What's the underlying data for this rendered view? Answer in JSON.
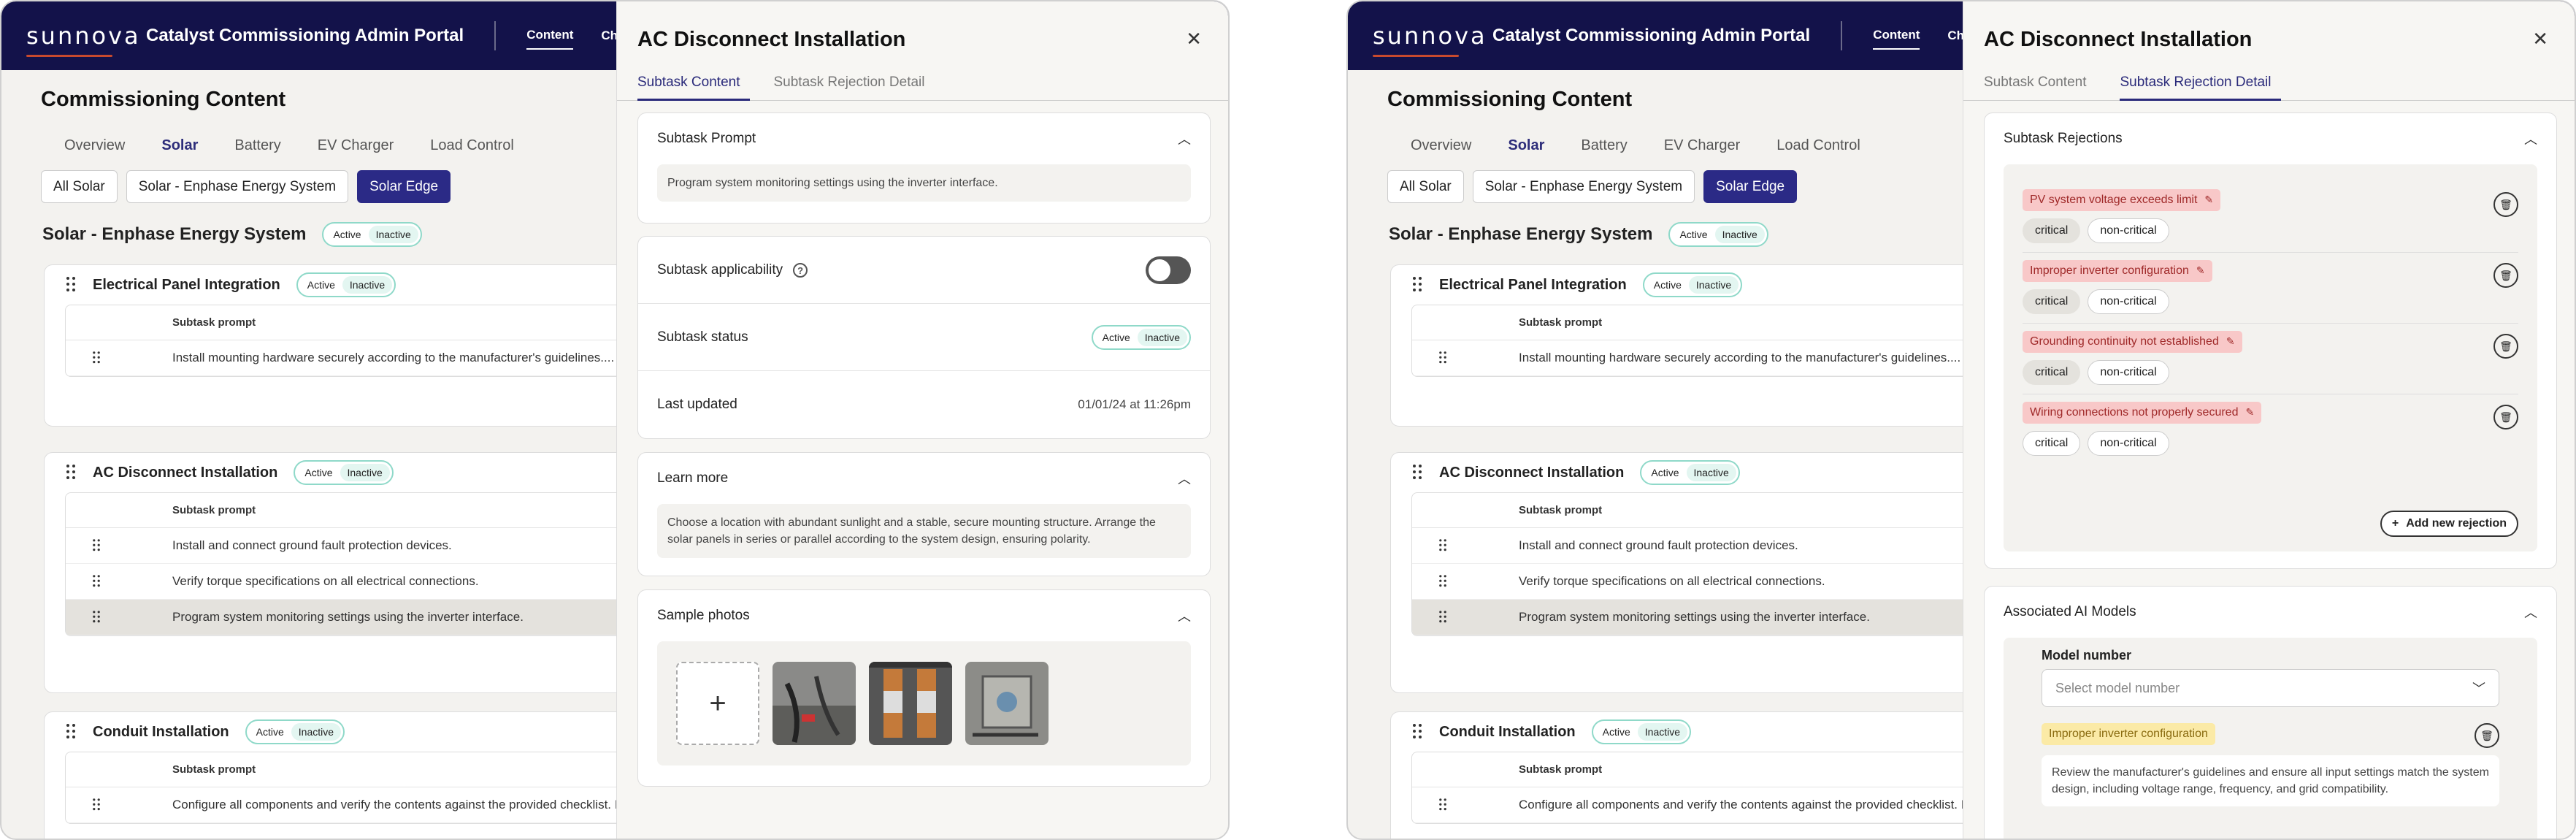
{
  "brand": {
    "logo": "sunnova",
    "app_title": "Catalyst Commissioning Admin Portal"
  },
  "nav": {
    "content": "Content",
    "change_log": "Change lo"
  },
  "page": {
    "title": "Commissioning Content",
    "section": "Solar - Enphase Energy System"
  },
  "tabs": [
    "Overview",
    "Solar",
    "Battery",
    "EV Charger",
    "Load Control"
  ],
  "pills": [
    "All Solar",
    "Solar - Enphase Energy System",
    "Solar Edge"
  ],
  "toggle": {
    "active": "Active",
    "inactive": "Inactive"
  },
  "cards": [
    {
      "title": "Electrical Panel Integration",
      "header": "Subtask prompt",
      "rows": [
        "Install mounting hardware securely according to the manufacturer's guidelines...."
      ]
    },
    {
      "title": "AC Disconnect Installation",
      "header": "Subtask prompt",
      "rows": [
        "Install and connect ground fault protection devices.",
        "Verify torque specifications on all electrical connections.",
        "Program system monitoring settings using the inverter interface."
      ]
    },
    {
      "title": "Conduit Installation",
      "header": "Subtask prompt",
      "rows": [
        "Configure all components and verify the contents against the provided checklist. Install"
      ]
    }
  ],
  "panel": {
    "title": "AC Disconnect Installation",
    "close_icon": "close-icon",
    "tab_content": "Subtask Content",
    "tab_rejection": "Subtask Rejection Detail",
    "prompt_title": "Subtask Prompt",
    "prompt_text": "Program system monitoring settings using the inverter interface.",
    "applicability": "Subtask applicability",
    "status": "Subtask status",
    "last_updated_label": "Last updated",
    "last_updated_value": "01/01/24 at 11:26pm",
    "learn_more": "Learn more",
    "learn_more_text": "Choose a location with abundant sunlight and a stable, secure mounting structure. Arrange the solar panels in series or parallel according to the system design, ensuring polarity.",
    "sample_photos": "Sample photos",
    "rejections_title": "Subtask Rejections",
    "rejections": [
      {
        "label": "PV system voltage exceeds limit",
        "selected": "critical"
      },
      {
        "label": "Improper inverter configuration",
        "selected": "critical"
      },
      {
        "label": "Grounding continuity not established",
        "selected": "critical"
      },
      {
        "label": "Wiring connections not properly secured",
        "selected": "none"
      }
    ],
    "critical": "critical",
    "non_critical": "non-critical",
    "add_rejection": "Add new rejection",
    "ai_models": "Associated AI Models",
    "model_number": "Model number",
    "model_placeholder": "Select model number",
    "ai_tag": "Improper inverter configuration",
    "ai_text": "Review the manufacturer's guidelines and ensure all input settings match the system design, including voltage range, frequency, and grid compatibility."
  }
}
